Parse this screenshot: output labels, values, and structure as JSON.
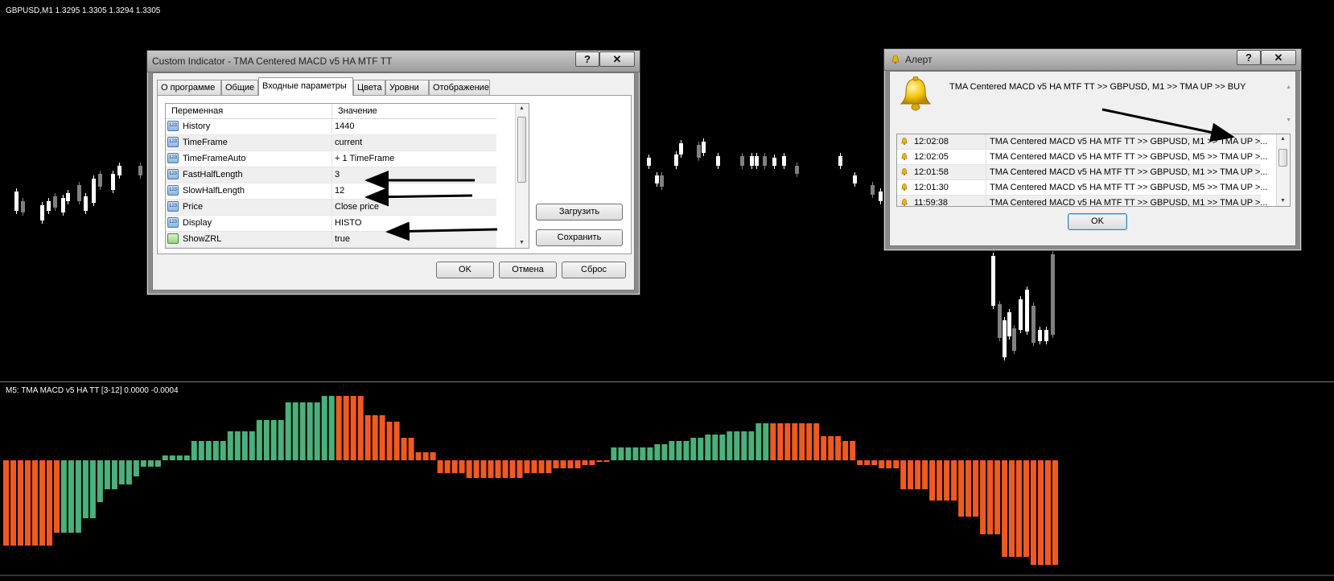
{
  "main_chart": {
    "caption": "GBPUSD,M1  1.3295 1.3305 1.3294 1.3305"
  },
  "indicator_chart": {
    "caption": "M5: TMA MACD v5 HA TT [3-12] 0.0000 -0.0004"
  },
  "colors": {
    "background": "#000000",
    "bull_bar": "#4cb07a",
    "bear_bar": "#f05a22",
    "candle_bull": "#ffffff",
    "candle_bear": "#808080",
    "arrow": "#000000"
  },
  "indicator_dialog": {
    "title": "Custom Indicator - TMA Centered MACD v5 HA MTF TT",
    "help_btn": "?",
    "close_btn": "✕",
    "tabs": [
      "О программе",
      "Общие",
      "Входные параметры",
      "Цвета",
      "Уровни",
      "Отображение"
    ],
    "active_tab": "Входные параметры",
    "columns": {
      "name": "Переменная",
      "value": "Значение"
    },
    "params": [
      {
        "name": "History",
        "value": "1440",
        "icon": "number-icon"
      },
      {
        "name": "TimeFrame",
        "value": "current",
        "icon": "number-icon"
      },
      {
        "name": "TimeFrameAuto",
        "value": "+ 1 TimeFrame",
        "icon": "number-icon"
      },
      {
        "name": "FastHalfLength",
        "value": "3",
        "icon": "number-icon"
      },
      {
        "name": "SlowHalfLength",
        "value": "12",
        "icon": "number-icon"
      },
      {
        "name": "Price",
        "value": "Close price",
        "icon": "number-icon"
      },
      {
        "name": "Display",
        "value": "HISTO",
        "icon": "number-icon"
      },
      {
        "name": "ShowZRL",
        "value": "true",
        "icon": "boolean-icon"
      }
    ],
    "load_btn": "Загрузить",
    "save_btn": "Сохранить",
    "ok_btn": "OK",
    "cancel_btn": "Отмена",
    "reset_btn": "Сброс"
  },
  "alert_dialog": {
    "title": "Алерт",
    "help_btn": "?",
    "close_btn": "✕",
    "message": "TMA Centered MACD v5 HA MTF TT >> GBPUSD, M1  >>  TMA UP  >>  BUY",
    "rows": [
      {
        "time": "12:02:08",
        "text": "TMA Centered MACD v5 HA MTF TT >> GBPUSD, M1  >>  TMA UP  >..."
      },
      {
        "time": "12:02:05",
        "text": "TMA Centered MACD v5 HA MTF TT >> GBPUSD, M5  >>  TMA UP  >..."
      },
      {
        "time": "12:01:58",
        "text": "TMA Centered MACD v5 HA MTF TT >> GBPUSD, M1  >>  TMA UP  >..."
      },
      {
        "time": "12:01:30",
        "text": "TMA Centered MACD v5 HA MTF TT >> GBPUSD, M5  >>  TMA UP  >..."
      },
      {
        "time": "11:59:38",
        "text": "TMA Centered MACD v5 HA MTF TT >> GBPUSD, M1  >>  TMA UP  >..."
      }
    ],
    "ok_btn": "OK"
  }
}
